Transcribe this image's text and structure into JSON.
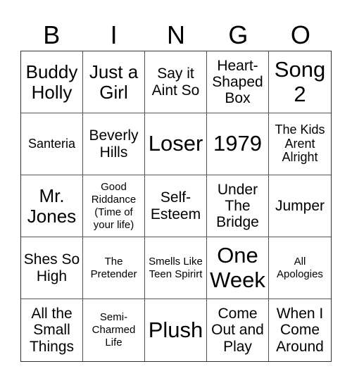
{
  "header": {
    "letters": [
      "B",
      "I",
      "N",
      "G",
      "O"
    ]
  },
  "cells": [
    {
      "text": "Buddy Holly",
      "size": "s-l"
    },
    {
      "text": "Just a Girl",
      "size": "s-l"
    },
    {
      "text": "Say it Aint So",
      "size": "s-m"
    },
    {
      "text": "Heart-Shaped Box",
      "size": "s-m"
    },
    {
      "text": "Song 2",
      "size": "s-xl"
    },
    {
      "text": "Santeria",
      "size": "s-s"
    },
    {
      "text": "Beverly Hills",
      "size": "s-m"
    },
    {
      "text": "Loser",
      "size": "s-xl"
    },
    {
      "text": "1979",
      "size": "s-xl"
    },
    {
      "text": "The Kids Arent Alright",
      "size": "s-s"
    },
    {
      "text": "Mr. Jones",
      "size": "s-l"
    },
    {
      "text": "Good Riddance (Time of your life)",
      "size": "s-xs"
    },
    {
      "text": "Self-Esteem",
      "size": "s-m"
    },
    {
      "text": "Under The Bridge",
      "size": "s-m"
    },
    {
      "text": "Jumper",
      "size": "s-m"
    },
    {
      "text": "Shes So High",
      "size": "s-m"
    },
    {
      "text": "The Pretender",
      "size": "s-xs"
    },
    {
      "text": "Smells Like Teen Spirirt",
      "size": "s-xs"
    },
    {
      "text": "One Week",
      "size": "s-xl"
    },
    {
      "text": "All Apologies",
      "size": "s-xs"
    },
    {
      "text": "All the Small Things",
      "size": "s-m"
    },
    {
      "text": "Semi-Charmed Life",
      "size": "s-xs"
    },
    {
      "text": "Plush",
      "size": "s-xl"
    },
    {
      "text": "Come Out and Play",
      "size": "s-m"
    },
    {
      "text": "When I Come Around",
      "size": "s-m"
    }
  ]
}
